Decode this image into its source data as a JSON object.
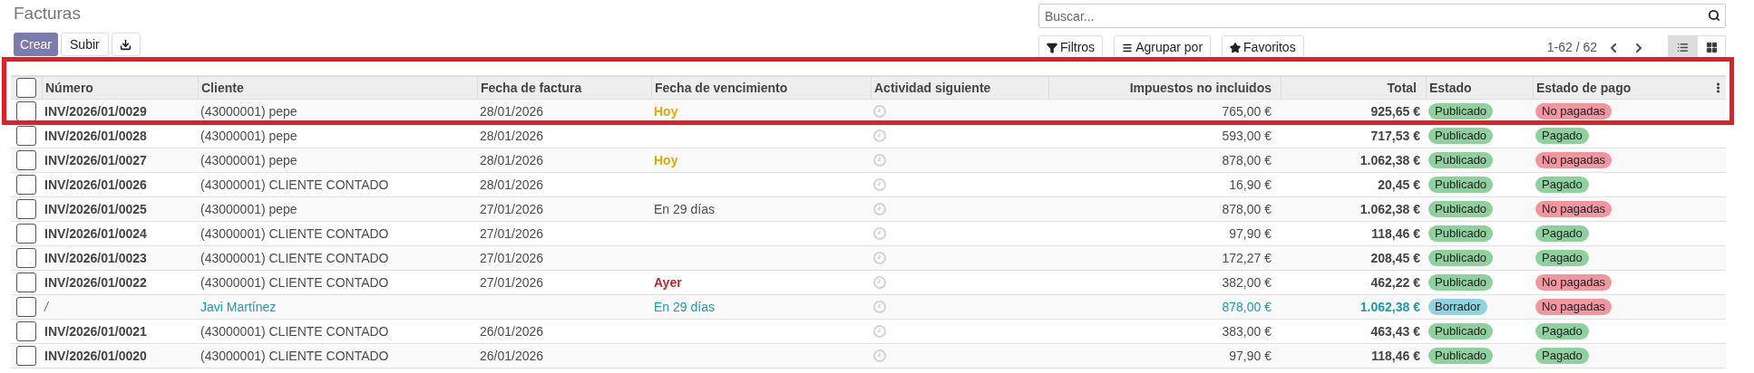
{
  "title": "Facturas",
  "actions": [
    {
      "kind": "primary",
      "label": "Crear"
    },
    {
      "kind": "plain",
      "label": "Subir"
    },
    {
      "kind": "download"
    }
  ],
  "search": {
    "placeholder": "Buscar..."
  },
  "filters": [
    {
      "kind": "filter",
      "label": "Filtros"
    },
    {
      "kind": "group",
      "label": "Agrupar por"
    },
    {
      "kind": "star",
      "label": "Favoritos"
    }
  ],
  "pager": "1-62 / 62",
  "views": [
    {
      "kind": "list",
      "selected": true
    },
    {
      "kind": "kanban",
      "selected": false
    }
  ],
  "table": {
    "select_all": {
      "checked": false
    },
    "columns": [
      "Número",
      "Cliente",
      "Fecha de factura",
      "Fecha de vencimiento",
      "Actividad siguiente",
      "Impuestos no incluidos",
      "Total",
      "Estado",
      "Estado de pago"
    ],
    "rows": [
      {
        "checked": false,
        "draft": false,
        "number": "INV/2026/01/0029",
        "client": "(43000001) pepe",
        "date": "28/01/2026",
        "due": {
          "text": "Hoy",
          "kind": "today"
        },
        "untaxed": "765,00 €",
        "total": "925,65 €",
        "status": {
          "text": "Publicado",
          "color": "#8fd19e"
        },
        "payment": {
          "text": "No pagadas",
          "color": "#f1969f"
        }
      },
      {
        "checked": false,
        "draft": false,
        "number": "INV/2026/01/0028",
        "client": "(43000001) pepe",
        "date": "28/01/2026",
        "untaxed": "593,00 €",
        "total": "717,53 €",
        "status": {
          "text": "Publicado",
          "color": "#8fd19e"
        },
        "payment": {
          "text": "Pagado",
          "color": "#8fd19e"
        }
      },
      {
        "checked": false,
        "draft": false,
        "number": "INV/2026/01/0027",
        "client": "(43000001) pepe",
        "date": "28/01/2026",
        "due": {
          "text": "Hoy",
          "kind": "today"
        },
        "untaxed": "878,00 €",
        "total": "1.062,38 €",
        "status": {
          "text": "Publicado",
          "color": "#8fd19e"
        },
        "payment": {
          "text": "No pagadas",
          "color": "#f1969f"
        }
      },
      {
        "checked": false,
        "draft": false,
        "number": "INV/2026/01/0026",
        "client": "(43000001) CLIENTE CONTADO",
        "date": "28/01/2026",
        "untaxed": "16,90 €",
        "total": "20,45 €",
        "status": {
          "text": "Publicado",
          "color": "#8fd19e"
        },
        "payment": {
          "text": "Pagado",
          "color": "#8fd19e"
        }
      },
      {
        "checked": false,
        "draft": false,
        "number": "INV/2026/01/0025",
        "client": "(43000001) pepe",
        "date": "27/01/2026",
        "due": {
          "text": "En 29 días",
          "kind": "normal"
        },
        "untaxed": "878,00 €",
        "total": "1.062,38 €",
        "status": {
          "text": "Publicado",
          "color": "#8fd19e"
        },
        "payment": {
          "text": "No pagadas",
          "color": "#f1969f"
        }
      },
      {
        "checked": false,
        "draft": false,
        "number": "INV/2026/01/0024",
        "client": "(43000001) CLIENTE CONTADO",
        "date": "27/01/2026",
        "untaxed": "97,90 €",
        "total": "118,46 €",
        "status": {
          "text": "Publicado",
          "color": "#8fd19e"
        },
        "payment": {
          "text": "Pagado",
          "color": "#8fd19e"
        }
      },
      {
        "checked": false,
        "draft": false,
        "number": "INV/2026/01/0023",
        "client": "(43000001) CLIENTE CONTADO",
        "date": "27/01/2026",
        "untaxed": "172,27 €",
        "total": "208,45 €",
        "status": {
          "text": "Publicado",
          "color": "#8fd19e"
        },
        "payment": {
          "text": "Pagado",
          "color": "#8fd19e"
        }
      },
      {
        "checked": false,
        "draft": false,
        "number": "INV/2026/01/0022",
        "client": "(43000001) CLIENTE CONTADO",
        "date": "27/01/2026",
        "due": {
          "text": "Ayer",
          "kind": "overdue"
        },
        "untaxed": "382,00 €",
        "total": "462,22 €",
        "status": {
          "text": "Publicado",
          "color": "#8fd19e"
        },
        "payment": {
          "text": "No pagadas",
          "color": "#f1969f"
        }
      },
      {
        "checked": false,
        "draft": true,
        "number": "/",
        "client": "Javi Martínez",
        "due": {
          "text": "En 29 días",
          "kind": "normal"
        },
        "untaxed": "878,00 €",
        "total": "1.062,38 €",
        "status": {
          "text": "Borrador",
          "color": "#8fd3e0"
        },
        "payment": {
          "text": "No pagadas",
          "color": "#f1969f"
        }
      },
      {
        "checked": false,
        "draft": false,
        "number": "INV/2026/01/0021",
        "client": "(43000001) CLIENTE CONTADO",
        "date": "26/01/2026",
        "untaxed": "383,00 €",
        "total": "463,43 €",
        "status": {
          "text": "Publicado",
          "color": "#8fd19e"
        },
        "payment": {
          "text": "Pagado",
          "color": "#8fd19e"
        }
      },
      {
        "checked": false,
        "draft": false,
        "number": "INV/2026/01/0020",
        "client": "(43000001) CLIENTE CONTADO",
        "date": "26/01/2026",
        "untaxed": "97,90 €",
        "total": "118,46 €",
        "status": {
          "text": "Publicado",
          "color": "#8fd19e"
        },
        "payment": {
          "text": "Pagado",
          "color": "#8fd19e"
        }
      }
    ]
  }
}
